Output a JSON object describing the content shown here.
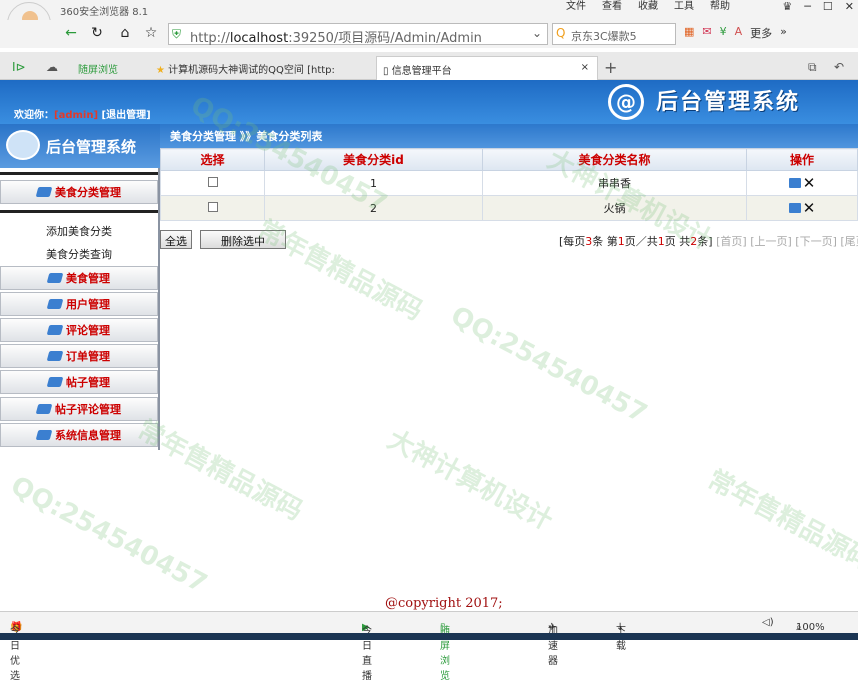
{
  "browser": {
    "title": "360安全浏览器 8.1",
    "menu": [
      "文件",
      "查看",
      "收藏",
      "工具",
      "帮助"
    ],
    "url_prefix": "http://",
    "url_host": "localhost",
    "url_rest": ":39250/项目源码/Admin/Admin",
    "search_text": "京东3C爆款5",
    "more_label": "更多",
    "tabs": [
      {
        "label": "随屏浏览"
      },
      {
        "label": "计算机源码大神调试的QQ空间 [http:"
      },
      {
        "label": "信息管理平台"
      }
    ],
    "status": {
      "left": "今日优选",
      "live": "今日直播",
      "screen": "随屏浏览",
      "accel": "加速器",
      "download": "下载",
      "zoom": "100%"
    }
  },
  "header": {
    "system_title": "后台管理系统",
    "welcome_prefix": "欢迎你：",
    "user": "[admin]",
    "logout": "[退出管理]"
  },
  "sidebar": {
    "title": "后台管理系统",
    "active_group": "美食分类管理",
    "sub_items": [
      "添加美食分类",
      "美食分类查询"
    ],
    "groups": [
      "美食管理",
      "用户管理",
      "评论管理",
      "订单管理",
      "帖子管理",
      "帖子评论管理",
      "系统信息管理"
    ]
  },
  "main": {
    "breadcrumb": "美食分类管理 》》美食分类列表",
    "columns": [
      "选择",
      "美食分类id",
      "美食分类名称",
      "操作"
    ],
    "rows": [
      {
        "id": "1",
        "name": "串串香"
      },
      {
        "id": "2",
        "name": "火锅"
      }
    ],
    "select_all": "全选",
    "delete_selected": "删除选中",
    "pager": {
      "p1": "[每页",
      "per": "3",
      "p2": "条 第",
      "cur": "1",
      "p3": "页／共",
      "total_pages": "1",
      "p4": "页 共",
      "total": "2",
      "p5": "条]",
      "first": "[首页]",
      "prev": "[上一页]",
      "next": "[下一页]",
      "last": "[尾页]"
    }
  },
  "footer": "@copyright 2017;",
  "watermarks": [
    "常年售精品源码",
    "QQ:254540457",
    "大神计算机设计"
  ]
}
